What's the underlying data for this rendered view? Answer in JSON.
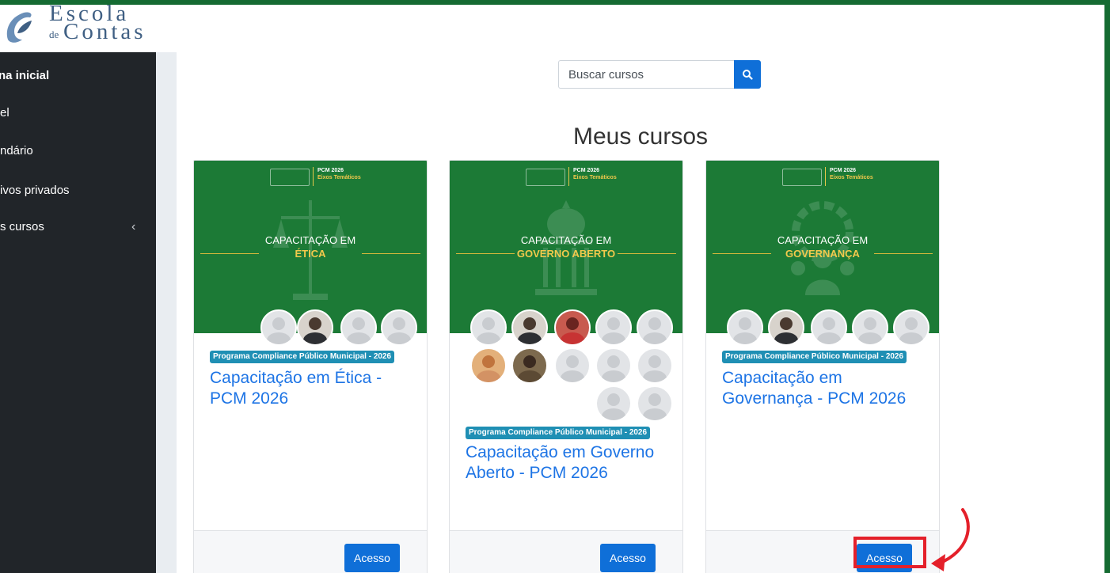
{
  "logo": {
    "word1": "Escola",
    "word_de": "de",
    "word2": "Contas"
  },
  "sidebar": {
    "items": [
      {
        "label": "na inicial",
        "bold": true
      },
      {
        "label": "el"
      },
      {
        "label": "ndário"
      },
      {
        "label": "ivos privados"
      },
      {
        "label": "s cursos",
        "chevron": "‹"
      }
    ]
  },
  "search": {
    "placeholder": "Buscar cursos"
  },
  "main": {
    "title": "Meus cursos"
  },
  "banner_text": {
    "program": "PCM 2026",
    "sub": "Eixos Temáticos",
    "cap": "CAPACITAÇÃO EM"
  },
  "courses": [
    {
      "subject": "ÉTICA",
      "category": "Programa Compliance Público Municipal - 2026",
      "title": "Capacitação em Ética - PCM 2026",
      "button": "Acesso"
    },
    {
      "subject": "GOVERNO ABERTO",
      "category": "Programa Compliance Público Municipal - 2026",
      "title": "Capacitação em Governo Aberto - PCM 2026",
      "button": "Acesso"
    },
    {
      "subject": "GOVERNANÇA",
      "category": "Programa Compliance Público Municipal - 2026",
      "title": "Capacitação em Governança - PCM 2026",
      "button": "Acesso"
    }
  ],
  "colors": {
    "accent": "#0f6fd8",
    "sidebar": "#212529",
    "frame": "#156b32",
    "highlight": "#e4202a",
    "badge": "#1f8fb4"
  }
}
